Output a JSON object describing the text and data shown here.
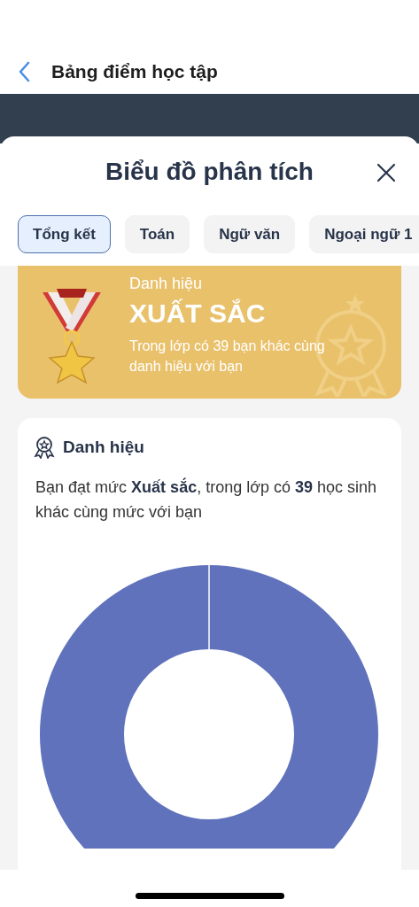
{
  "header": {
    "title": "Bảng điểm học tập"
  },
  "sheet": {
    "title": "Biểu đồ phân tích"
  },
  "tabs": [
    {
      "label": "Tổng kết",
      "selected": true
    },
    {
      "label": "Toán",
      "selected": false
    },
    {
      "label": "Ngữ văn",
      "selected": false
    },
    {
      "label": "Ngoại ngữ 1",
      "selected": false
    }
  ],
  "banner": {
    "label": "Danh hiệu",
    "title": "XUẤT SẮC",
    "description": "Trong lớp có 39 bạn khác cùng danh hiệu với bạn"
  },
  "card": {
    "heading": "Danh hiệu",
    "text": "Bạn đạt mức **Xuất sắc**, trong lớp có **39** học sinh khác cùng mức với bạn"
  }
}
